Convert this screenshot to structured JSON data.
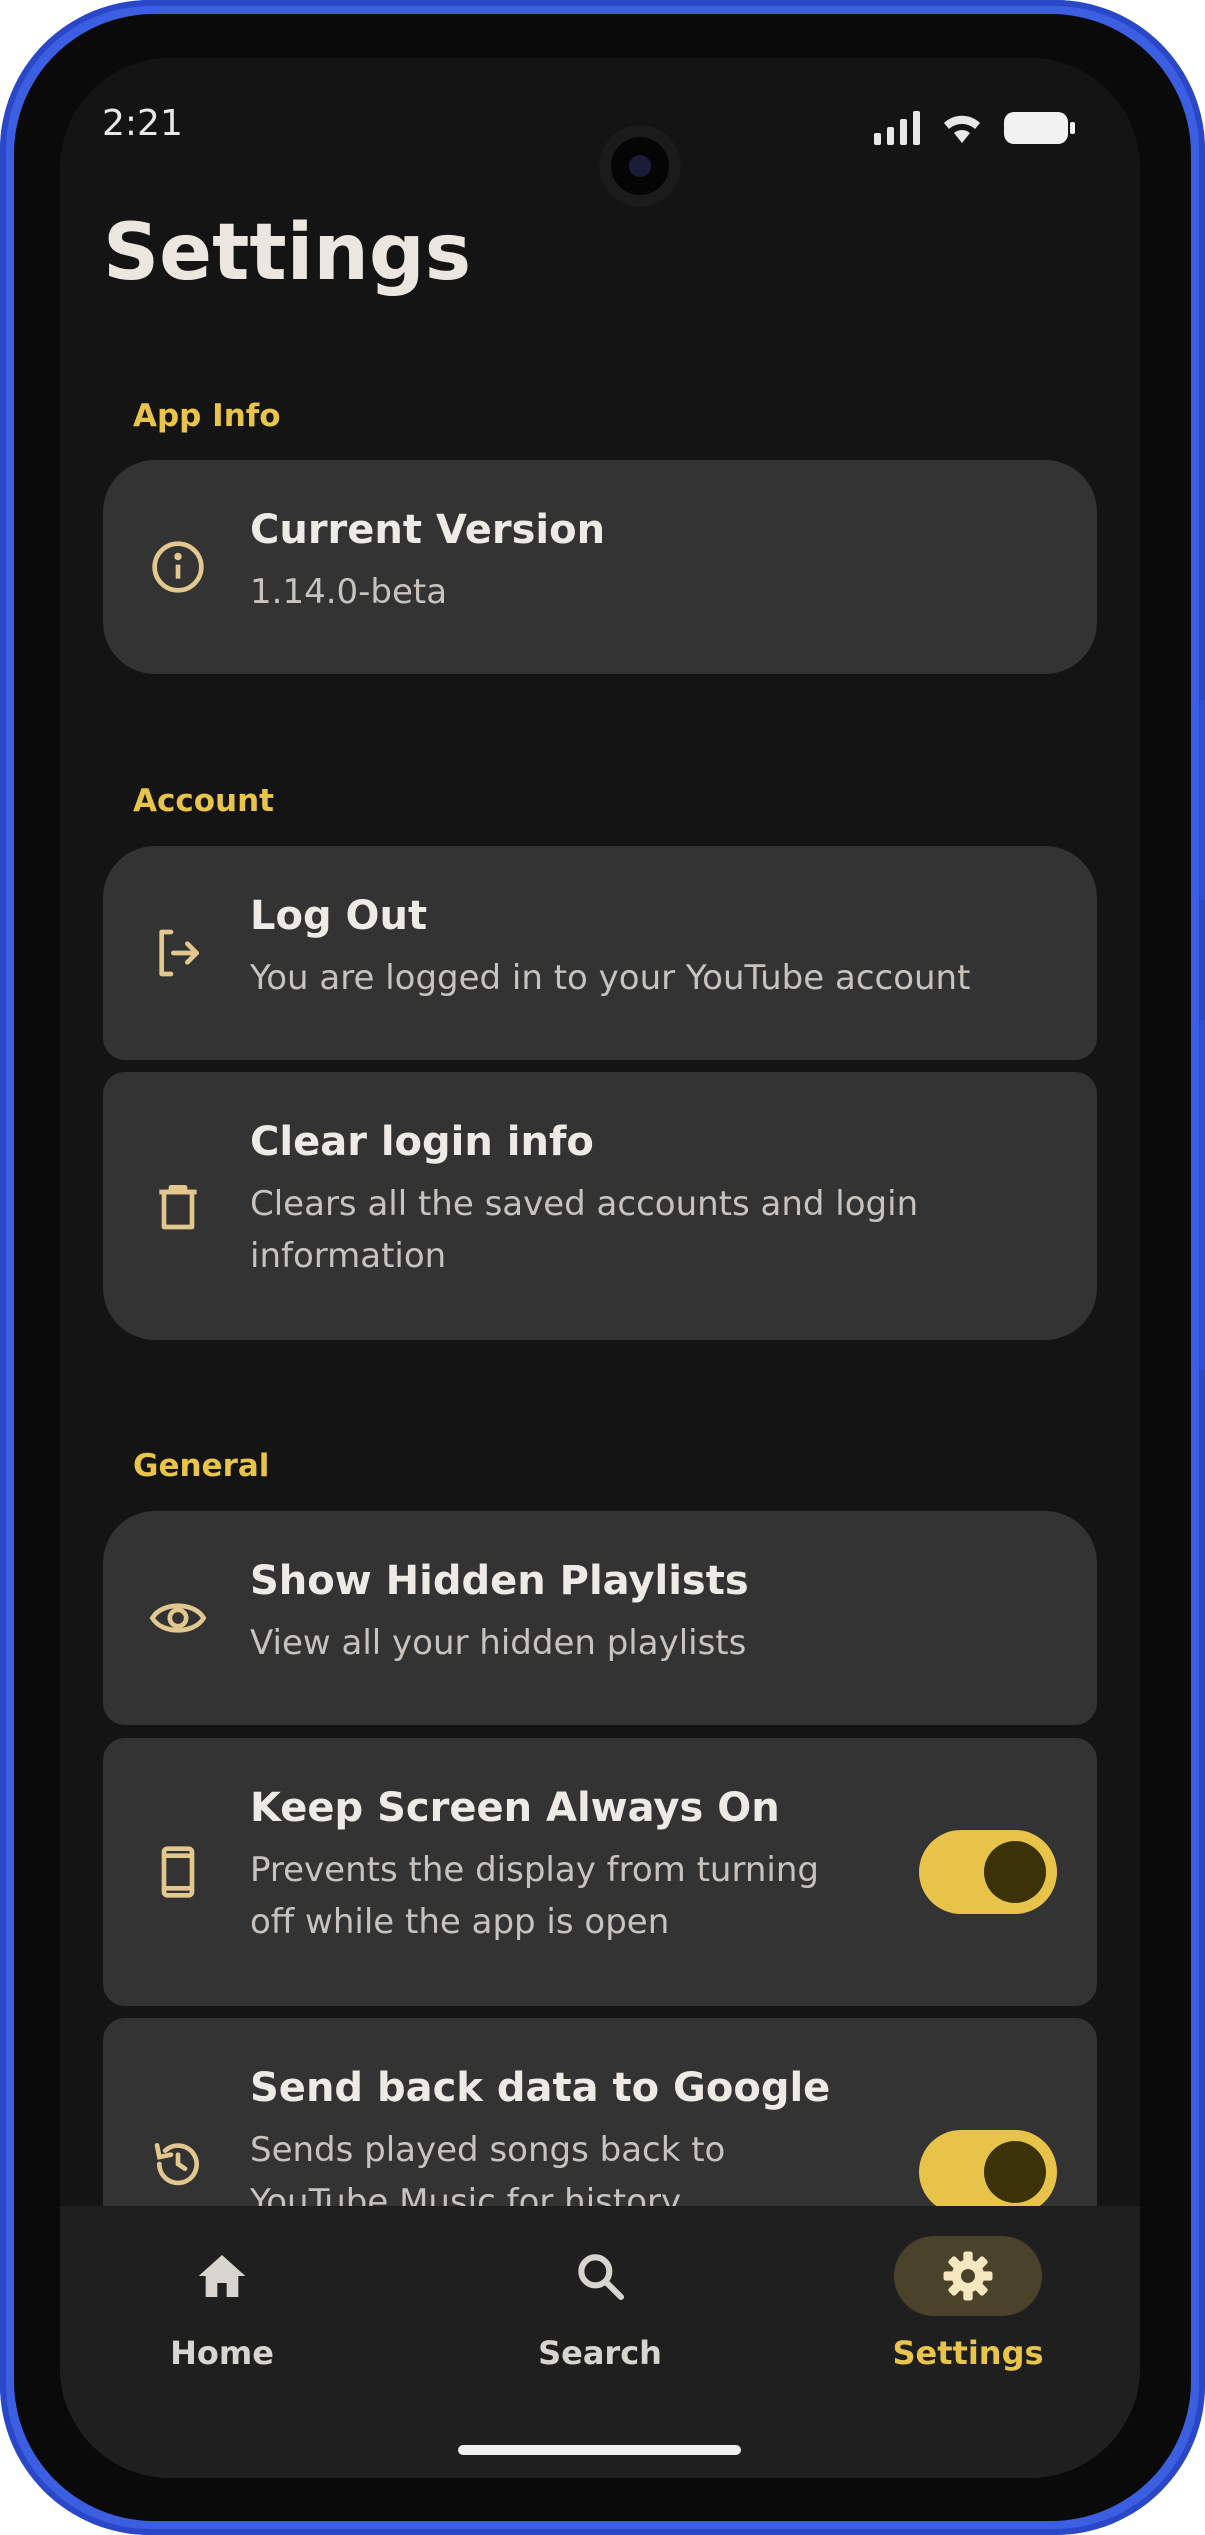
{
  "status_bar": {
    "time": "2:21"
  },
  "page": {
    "title": "Settings"
  },
  "sections": {
    "app_info": {
      "label": "App Info",
      "items": [
        {
          "title": "Current Version",
          "subtitle": "1.14.0-beta",
          "icon": "info-icon"
        }
      ]
    },
    "account": {
      "label": "Account",
      "items": [
        {
          "title": "Log Out",
          "subtitle": "You are logged in to your YouTube account",
          "icon": "logout-icon"
        },
        {
          "title": "Clear login info",
          "subtitle": "Clears all the saved accounts and login information",
          "icon": "trash-icon"
        }
      ]
    },
    "general": {
      "label": "General",
      "items": [
        {
          "title": "Show Hidden Playlists",
          "subtitle": "View all your hidden playlists",
          "icon": "eye-icon"
        },
        {
          "title": "Keep Screen Always On",
          "subtitle": "Prevents the display from turning off while the app is open",
          "icon": "phone-icon",
          "toggle_on": true
        },
        {
          "title": "Send back data to Google",
          "subtitle": "Sends played songs back to YouTube Music for history recommendations",
          "icon": "history-icon",
          "toggle_on": true
        }
      ]
    }
  },
  "nav": {
    "items": [
      {
        "label": "Home",
        "icon": "home-icon",
        "active": false
      },
      {
        "label": "Search",
        "icon": "search-icon",
        "active": false
      },
      {
        "label": "Settings",
        "icon": "gear-icon",
        "active": true
      }
    ]
  },
  "colors": {
    "accent": "#e9c44a",
    "background": "#141414",
    "card": "#333333",
    "frame": "#3b5fe0"
  }
}
